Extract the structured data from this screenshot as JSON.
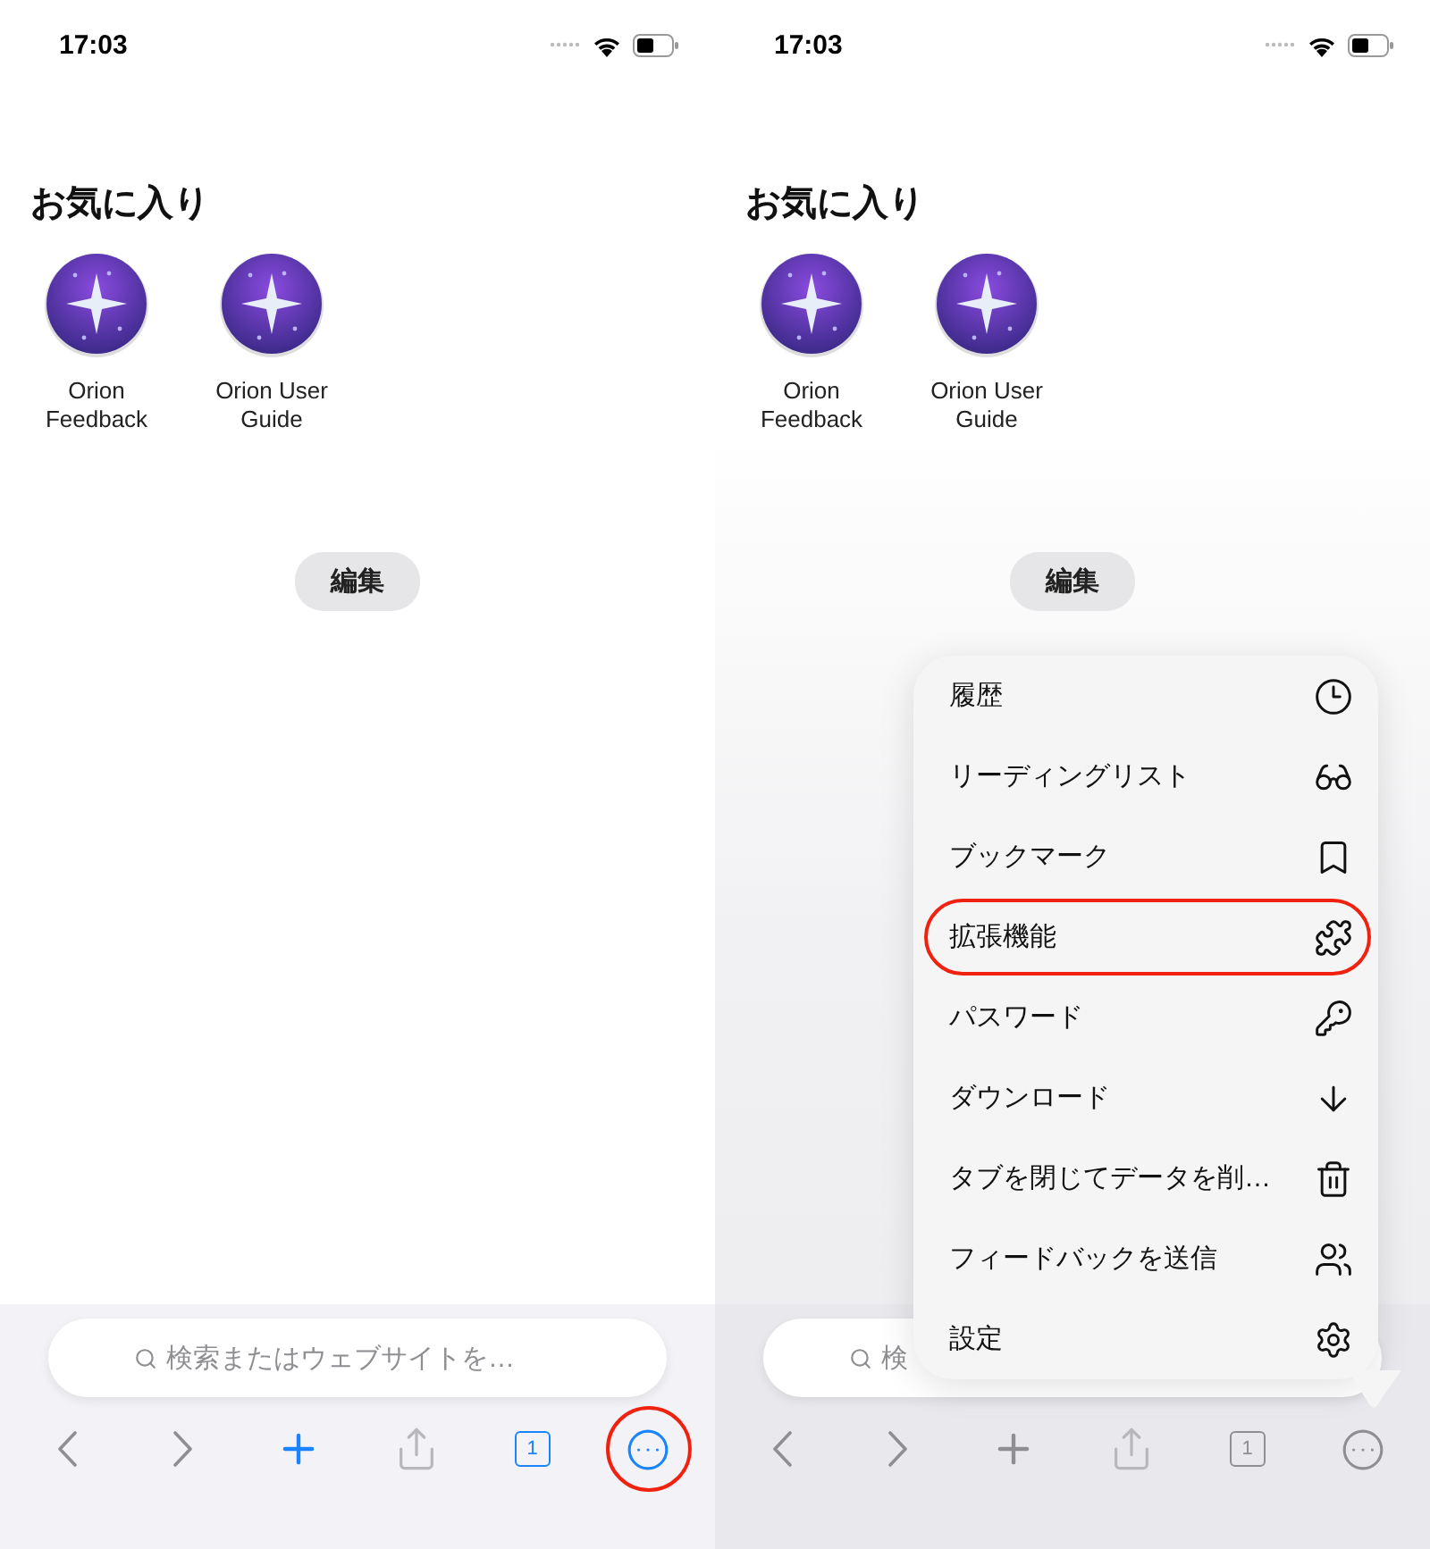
{
  "screens": [
    {
      "status_bar": {
        "time": "17:03"
      },
      "favorites": {
        "title": "お気に入り",
        "items": [
          {
            "label": "Orion Feedback"
          },
          {
            "label": "Orion User Guide"
          }
        ]
      },
      "edit_button": "編集",
      "search": {
        "placeholder": "検索またはウェブサイトを…"
      },
      "toolbar": [
        {
          "kind": "back",
          "active": false,
          "highlighted": false
        },
        {
          "kind": "forward",
          "active": false,
          "highlighted": false
        },
        {
          "kind": "new_tab",
          "active": true,
          "highlighted": false
        },
        {
          "kind": "share",
          "active": false,
          "highlighted": false
        },
        {
          "kind": "tabs",
          "label": "1",
          "active": true,
          "highlighted": false
        },
        {
          "kind": "more",
          "active": true,
          "highlighted": true
        }
      ]
    },
    {
      "status_bar": {
        "time": "17:03"
      },
      "favorites": {
        "title": "お気に入り",
        "items": [
          {
            "label": "Orion Feedback"
          },
          {
            "label": "Orion User Guide"
          }
        ]
      },
      "edit_button": "編集",
      "search": {
        "placeholder": "検"
      },
      "toolbar": [
        {
          "kind": "back",
          "active": false,
          "highlighted": false
        },
        {
          "kind": "forward",
          "active": false,
          "highlighted": false
        },
        {
          "kind": "new_tab",
          "active": false,
          "highlighted": false
        },
        {
          "kind": "share",
          "active": false,
          "highlighted": false
        },
        {
          "kind": "tabs",
          "label": "1",
          "active": false,
          "highlighted": false
        },
        {
          "kind": "more",
          "active": false,
          "highlighted": false
        }
      ],
      "menu": {
        "items": [
          {
            "kind": "history",
            "label": "履歴",
            "highlighted": false
          },
          {
            "kind": "reading_list",
            "label": "リーディングリスト",
            "highlighted": false
          },
          {
            "kind": "bookmarks",
            "label": "ブックマーク",
            "highlighted": false
          },
          {
            "kind": "extensions",
            "label": "拡張機能",
            "highlighted": true
          },
          {
            "kind": "passwords",
            "label": "パスワード",
            "highlighted": false
          },
          {
            "kind": "downloads",
            "label": "ダウンロード",
            "highlighted": false
          },
          {
            "kind": "close_tabs",
            "label": "タブを閉じてデータを削…",
            "highlighted": false
          },
          {
            "kind": "feedback",
            "label": "フィードバックを送信",
            "highlighted": false
          },
          {
            "kind": "settings",
            "label": "設定",
            "highlighted": false
          }
        ]
      }
    }
  ]
}
